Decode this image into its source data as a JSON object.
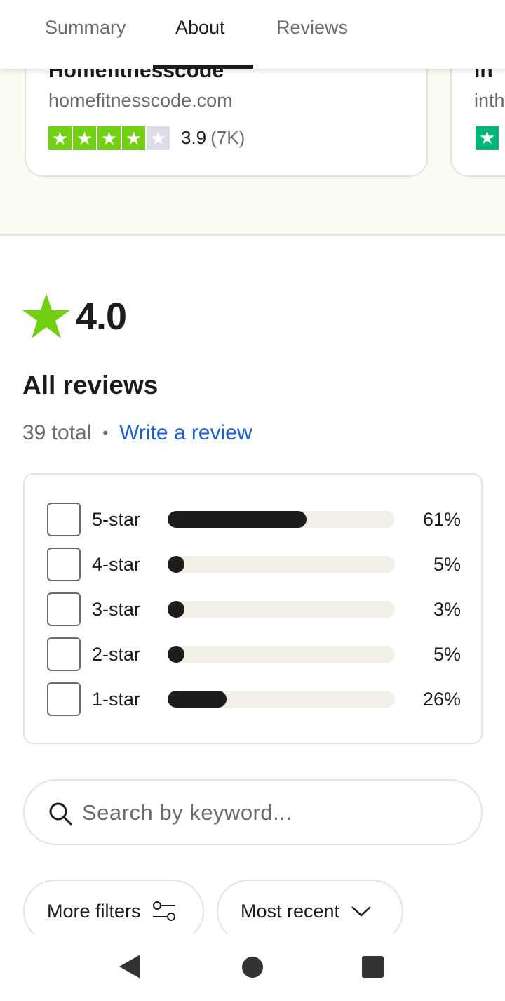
{
  "tabs": [
    {
      "label": "Summary",
      "active": false
    },
    {
      "label": "About",
      "active": true
    },
    {
      "label": "Reviews",
      "active": false
    }
  ],
  "company_card": {
    "name": "Homefitnesscode",
    "domain": "homefitnesscode.com",
    "stars_filled": 4,
    "stars_total": 5,
    "rating": "3.9",
    "review_count": "(7K)",
    "star_color": "#73cf11"
  },
  "company_card_2": {
    "name": "In",
    "domain": "inth",
    "star_color": "#00b67a"
  },
  "summary": {
    "rating": "4.0",
    "star_color": "#73cf11",
    "heading": "All reviews",
    "total": "39 total",
    "separator": "•",
    "write_review": "Write a review"
  },
  "distribution": [
    {
      "label": "5-star",
      "percent_text": "61%",
      "percent": 61
    },
    {
      "label": "4-star",
      "percent_text": "5%",
      "percent": 5
    },
    {
      "label": "3-star",
      "percent_text": "3%",
      "percent": 3
    },
    {
      "label": "2-star",
      "percent_text": "5%",
      "percent": 5
    },
    {
      "label": "1-star",
      "percent_text": "26%",
      "percent": 26
    }
  ],
  "search": {
    "placeholder": "Search by keyword..."
  },
  "filters": {
    "more_filters": "More filters",
    "sort": "Most recent"
  },
  "colors": {
    "link": "#1c5fce",
    "bar": "#1c1c1c",
    "track": "#f1efe6"
  }
}
